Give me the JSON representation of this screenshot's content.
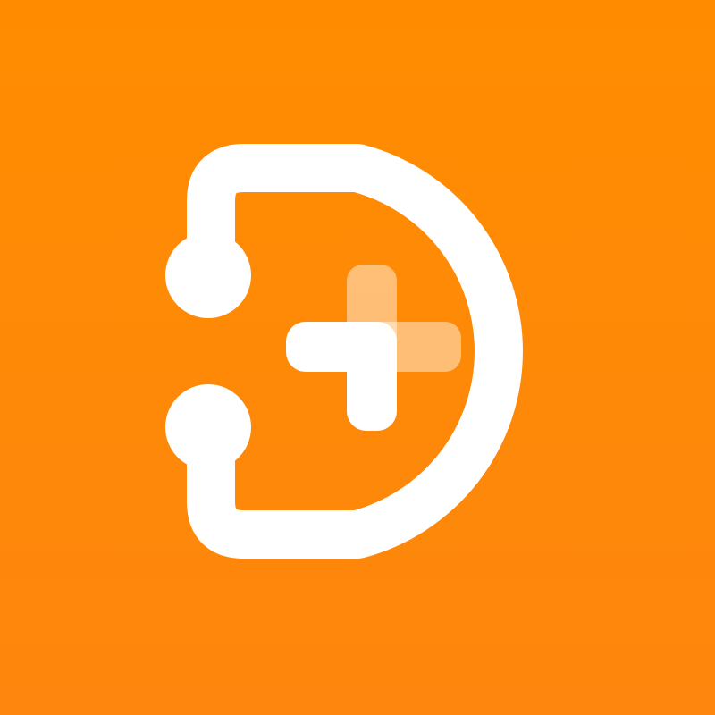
{
  "app_icon": {
    "icon_name": "medical-stethoscope-d-logo-icon",
    "colors": {
      "background": "#FF8C00",
      "foreground": "#FFFFFF",
      "cross_secondary_opacity": 0.45
    }
  }
}
